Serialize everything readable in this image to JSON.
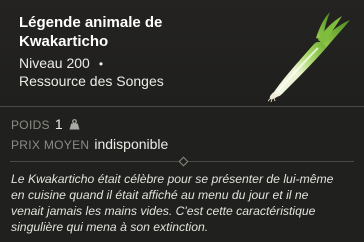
{
  "item": {
    "title_line1": "Légende animale de",
    "title_line2": "Kwakarticho",
    "level": "Niveau 200",
    "separator": "•",
    "category": "Ressource des Songes",
    "image_icon": "leek-icon"
  },
  "stats": {
    "weight_label": "POIDS",
    "weight_value": "1",
    "weight_icon": "weight-icon",
    "price_label": "PRIX MOYEN",
    "price_value": "indisponible"
  },
  "description": {
    "line1": "Le Kwakarticho était célèbre pour se présenter de lui-même",
    "line2": "en cuisine quand il était affiché au menu du jour et il ne",
    "line3": "venait jamais les mains vides. C'est cette caractéristique",
    "line4": "singulière qui mena à son extinction."
  },
  "colors": {
    "background": "#20201e",
    "divider": "#4a4943",
    "label": "#8c8b86",
    "text": "#ecebe6",
    "leek_green": "#7bbf3a"
  }
}
